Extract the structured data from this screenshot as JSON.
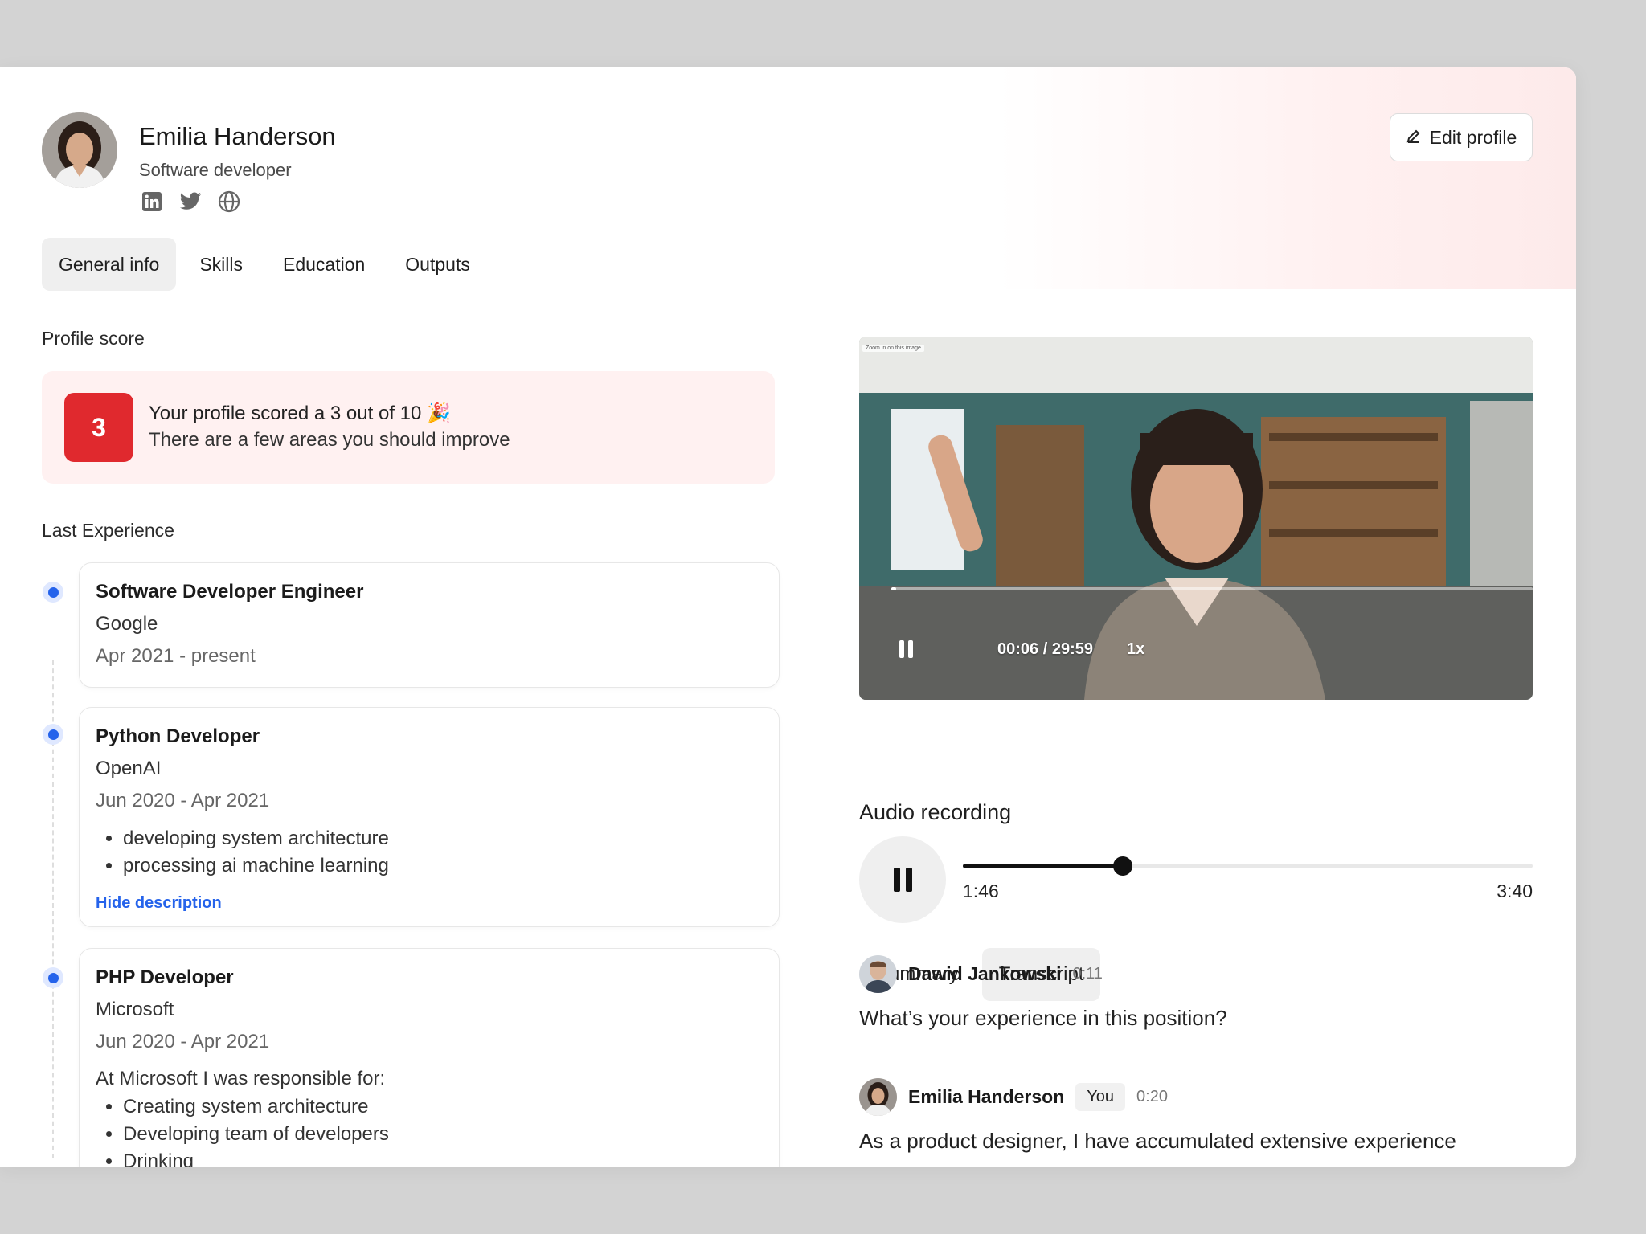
{
  "profile": {
    "name": "Emilia Handerson",
    "role": "Software developer",
    "edit_label": "Edit profile",
    "socials": [
      "linkedin-icon",
      "twitter-icon",
      "globe-icon"
    ]
  },
  "tabs": [
    {
      "label": "General info",
      "active": true
    },
    {
      "label": "Skills",
      "active": false
    },
    {
      "label": "Education",
      "active": false
    },
    {
      "label": "Outputs",
      "active": false
    }
  ],
  "score": {
    "section_title": "Profile score",
    "value": "3",
    "line1": "Your profile scored a 3 out of 10 🎉",
    "line2": "There are a few areas you should improve",
    "color": "#e0292e"
  },
  "experience": {
    "section_title": "Last Experience",
    "items": [
      {
        "title": "Software Developer Engineer",
        "company": "Google",
        "dates": "Apr 2021 - present"
      },
      {
        "title": "Python Developer",
        "company": "OpenAI",
        "dates": "Jun 2020 - Apr 2021",
        "bullets": [
          "developing system architecture",
          "processing ai machine learning"
        ],
        "toggle_label": "Hide description"
      },
      {
        "title": "PHP Developer",
        "company": "Microsoft",
        "dates": "Jun 2020 - Apr 2021",
        "intro": "At Microsoft I was responsible for:",
        "bullets": [
          "Creating system architecture",
          "Developing team of developers",
          "Drinking"
        ]
      }
    ]
  },
  "video": {
    "tag": "Zoom in on this image",
    "time": "00:06 / 29:59",
    "speed": "1x",
    "progress": 0.008
  },
  "audio": {
    "title": "Audio recording",
    "current": "1:46",
    "total": "3:40",
    "progress": 0.28
  },
  "transcript_tabs": [
    {
      "label": "Summary",
      "active": false
    },
    {
      "label": "Transcript",
      "active": true
    }
  ],
  "messages": [
    {
      "name": "Dawid Jankowski",
      "time": "0:11",
      "text": "What’s your experience in this position?"
    },
    {
      "name": "Emilia Handerson",
      "badge": "You",
      "time": "0:20",
      "text": "As a product designer, I have accumulated extensive experience"
    }
  ],
  "colors": {
    "accent": "#2563eb",
    "score_bg": "#fff1f1",
    "score_badge": "#e0292e"
  }
}
